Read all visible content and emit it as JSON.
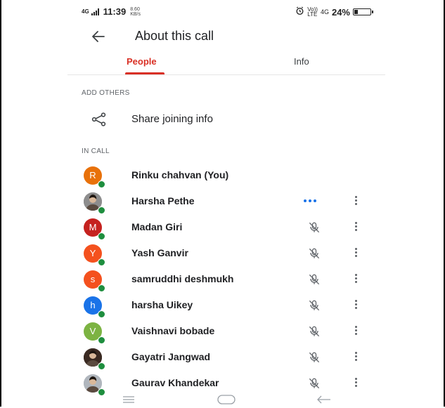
{
  "status_bar": {
    "network": "4G",
    "time": "11:39",
    "speed": "8.60",
    "speed_unit": "KB/s",
    "volte": "Vo))",
    "lte": "LTE",
    "net2": "4G",
    "battery": "24%",
    "battery_level": 0.24
  },
  "header": {
    "title": "About this call"
  },
  "tabs": [
    {
      "label": "People",
      "active": true
    },
    {
      "label": "Info",
      "active": false
    }
  ],
  "sections": {
    "add_others": "ADD OTHERS",
    "in_call": "IN CALL"
  },
  "share": {
    "label": "Share joining info"
  },
  "participants": [
    {
      "name": "Rinku chahvan (You)",
      "initial": "R",
      "color": "#e8710a",
      "photo": false,
      "status": "none"
    },
    {
      "name": "Harsha Pethe",
      "initial": "",
      "color": "#8d8d8d",
      "photo": true,
      "status": "speaking"
    },
    {
      "name": "Madan Giri",
      "initial": "M",
      "color": "#c5221f",
      "photo": false,
      "status": "muted"
    },
    {
      "name": "Yash Ganvir",
      "initial": "Y",
      "color": "#f4511e",
      "photo": false,
      "status": "muted"
    },
    {
      "name": "samruddhi deshmukh",
      "initial": "s",
      "color": "#f4511e",
      "photo": false,
      "status": "muted"
    },
    {
      "name": "harsha Uikey",
      "initial": "h",
      "color": "#1a73e8",
      "photo": false,
      "status": "muted"
    },
    {
      "name": "Vaishnavi bobade",
      "initial": "V",
      "color": "#7cb342",
      "photo": false,
      "status": "muted"
    },
    {
      "name": "Gayatri Jangwad",
      "initial": "",
      "color": "#3a2a22",
      "photo": true,
      "status": "muted"
    },
    {
      "name": "Gaurav Khandekar",
      "initial": "",
      "color": "#b0b6bd",
      "photo": true,
      "status": "muted"
    }
  ],
  "icons": {
    "back": "arrow-left-icon",
    "share": "share-icon",
    "mic_off": "mic-off-icon",
    "more": "more-vertical-icon",
    "nav_menu": "menu-icon",
    "nav_home": "home-icon",
    "nav_back": "back-icon"
  }
}
